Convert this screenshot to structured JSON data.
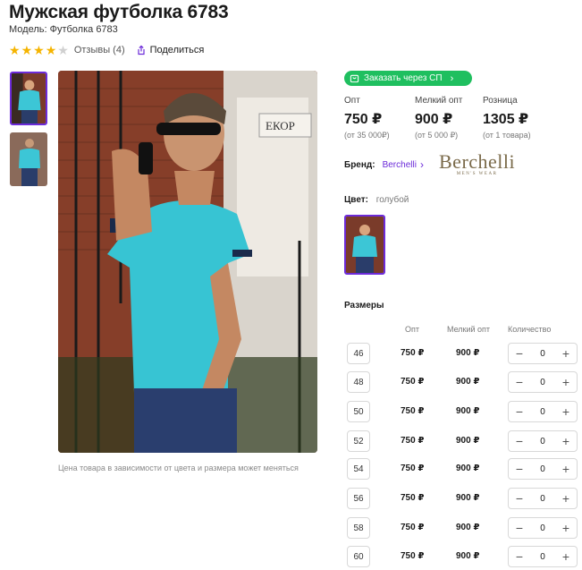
{
  "product": {
    "title": "Мужская футболка 6783",
    "model": "Модель: Футболка 6783",
    "rating": 4,
    "reviews": "Отзывы (4)",
    "share": "Поделиться"
  },
  "order_button": "Заказать через СП",
  "prices": [
    {
      "label": "Опт",
      "value": "750 ₽",
      "note": "(от 35 000₽)"
    },
    {
      "label": "Мелкий опт",
      "value": "900 ₽",
      "note": "(от 5 000 ₽)"
    },
    {
      "label": "Розница",
      "value": "1305 ₽",
      "note": "(от 1 товара)"
    }
  ],
  "brand": {
    "label": "Бренд:",
    "name": "Berchelli",
    "logo_text": "Berchelli",
    "logo_sub": "MEN'S WEAR"
  },
  "color": {
    "label": "Цвет:",
    "value": "голубой"
  },
  "price_note": "Цена товара в зависимости от цвета и размера может меняться",
  "sizes": {
    "title": "Размеры",
    "headers": {
      "opt": "Опт",
      "small_opt": "Мелкий опт",
      "qty": "Количество"
    },
    "rows": [
      {
        "size": "46",
        "opt": "750 ₽",
        "small_opt": "900 ₽",
        "qty": "0"
      },
      {
        "size": "48",
        "opt": "750 ₽",
        "small_opt": "900 ₽",
        "qty": "0"
      },
      {
        "size": "50",
        "opt": "750 ₽",
        "small_opt": "900 ₽",
        "qty": "0"
      },
      {
        "size": "52",
        "opt": "750 ₽",
        "small_opt": "900 ₽",
        "qty": "0"
      },
      {
        "size": "54",
        "opt": "750 ₽",
        "small_opt": "900 ₽",
        "qty": "0"
      },
      {
        "size": "56",
        "opt": "750 ₽",
        "small_opt": "900 ₽",
        "qty": "0"
      },
      {
        "size": "58",
        "opt": "750 ₽",
        "small_opt": "900 ₽",
        "qty": "0"
      },
      {
        "size": "60",
        "opt": "750 ₽",
        "small_opt": "900 ₽",
        "qty": "0"
      }
    ]
  },
  "stepper": {
    "minus": "−",
    "plus": "+"
  },
  "colors": {
    "accent": "#6c2bd9",
    "green": "#1fbf5f",
    "star": "#f5b400"
  }
}
